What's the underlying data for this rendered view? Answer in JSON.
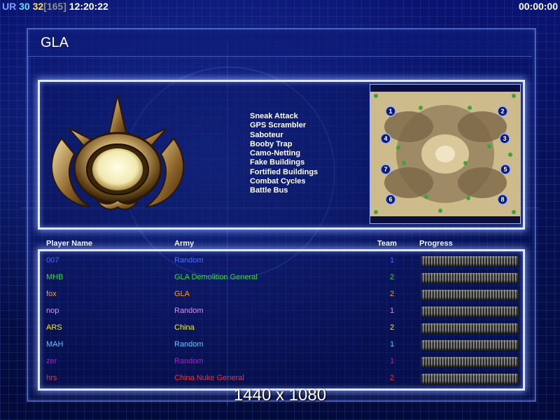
{
  "hud": {
    "prefix": "UR",
    "value_a": "30",
    "value_b": "32",
    "bracket": "[165]",
    "clock": "12:20:22",
    "timer": "00:00:00"
  },
  "faction": {
    "title": "GLA"
  },
  "powers": [
    "Sneak Attack",
    "GPS Scrambler",
    "Saboteur",
    "Booby Trap",
    "Camo-Netting",
    "Fake Buildings",
    "Fortified Buildings",
    "Combat Cycles",
    "Battle Bus"
  ],
  "minimap": {
    "start_positions": [
      "1",
      "2",
      "3",
      "4",
      "5",
      "6",
      "7",
      "8"
    ]
  },
  "table": {
    "headers": {
      "name": "Player Name",
      "army": "Army",
      "team": "Team",
      "progress": "Progress"
    },
    "rows": [
      {
        "name": "007",
        "army": "Random",
        "team": "1",
        "color": "#4a6bff",
        "progress": 1
      },
      {
        "name": "MHB",
        "army": "GLA Demolition General",
        "team": "2",
        "color": "#39d93a",
        "progress": 1
      },
      {
        "name": "fox",
        "army": "GLA",
        "team": "2",
        "color": "#ff9d1f",
        "progress": 1
      },
      {
        "name": "nop",
        "army": "Random",
        "team": "1",
        "color": "#d98cff",
        "progress": 1
      },
      {
        "name": "ARS",
        "army": "China",
        "team": "2",
        "color": "#f2ee2e",
        "progress": 1
      },
      {
        "name": "MAH",
        "army": "Random",
        "team": "1",
        "color": "#5fc8ff",
        "progress": 1
      },
      {
        "name": "zer",
        "army": "Random",
        "team": "1",
        "color": "#a021c4",
        "progress": 1
      },
      {
        "name": "hrs",
        "army": "China Nuke General",
        "team": "2",
        "color": "#ff2a2a",
        "progress": 1
      }
    ]
  },
  "resolution": "1440 x 1080"
}
